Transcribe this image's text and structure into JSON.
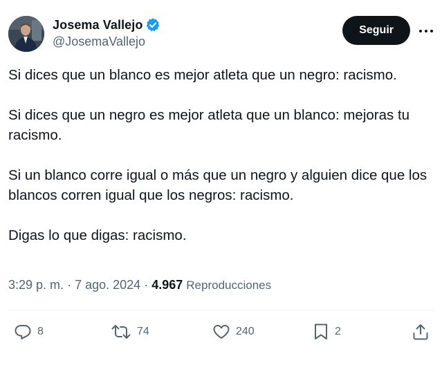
{
  "author": {
    "display_name": "Josema Vallejo",
    "handle": "@JosemaVallejo",
    "verified": true,
    "verified_color": "#1d9bf0"
  },
  "header": {
    "follow_label": "Seguir"
  },
  "tweet": {
    "paragraphs": [
      "Si dices que un blanco es mejor atleta que un negro: racismo.",
      "Si dices que un negro es mejor atleta que un blanco: mejoras tu racismo.",
      "Si un blanco corre igual o más que un negro y alguien dice que los blancos corren igual que los negros: racismo.",
      "Digas lo que digas: racismo."
    ],
    "time": "3:29 p. m.",
    "separator": "·",
    "date": "7 ago. 2024",
    "views_count": "4.967",
    "views_label": "Reproducciones"
  },
  "actions": {
    "replies": "8",
    "reposts": "74",
    "likes": "240",
    "bookmarks": "2"
  },
  "icons": {
    "reply": "reply-icon",
    "repost": "repost-icon",
    "like": "heart-icon",
    "bookmark": "bookmark-icon",
    "share": "share-icon",
    "more": "more-icon",
    "verified": "verified-badge-icon"
  },
  "colors": {
    "text": "#0f1419",
    "secondary": "#536471",
    "follow_bg": "#0f1419",
    "divider": "#eff3f4"
  }
}
